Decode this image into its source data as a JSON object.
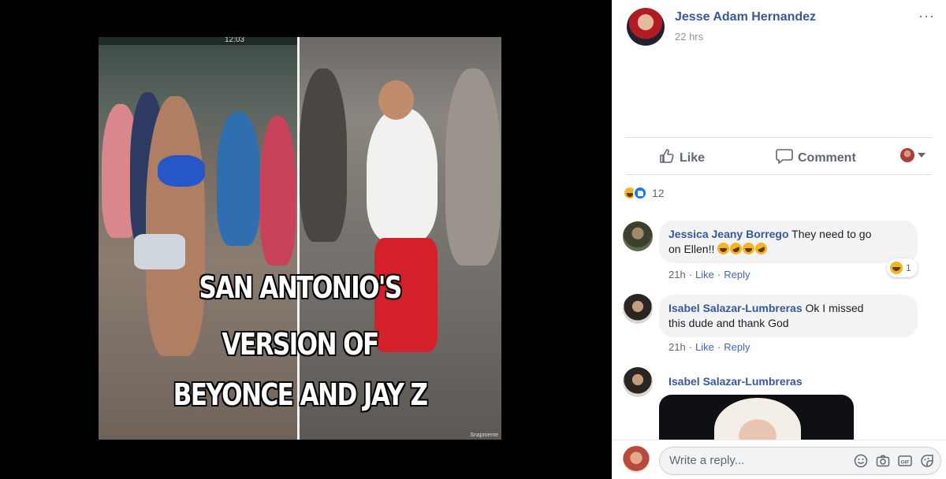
{
  "photo": {
    "status_time": "12:03",
    "caption_lines": [
      "SAN ANTONIO'S",
      "VERSION OF",
      "BEYONCE AND JAY Z"
    ],
    "watermark": "Snapmeme"
  },
  "post": {
    "author": "Jesse Adam Hernandez",
    "time": "22 hrs",
    "more": "···"
  },
  "actions": {
    "like_label": "Like",
    "comment_label": "Comment"
  },
  "reactions": {
    "count": "12",
    "types": [
      "haha",
      "like"
    ]
  },
  "comments": [
    {
      "author": "Jessica Jeany Borrego",
      "text_line1": "They need to go",
      "text_line2": "on Ellen!!",
      "time": "21h",
      "like": "Like",
      "reply": "Reply",
      "reaction_count": "1"
    },
    {
      "author": "Isabel Salazar-Lumbreras",
      "text_line1": "Ok I missed",
      "text_line2": "this dude and thank God",
      "time": "21h",
      "like": "Like",
      "reply": "Reply"
    },
    {
      "author": "Isabel Salazar-Lumbreras"
    }
  ],
  "reply_box": {
    "placeholder": "Write a reply..."
  },
  "colors": {
    "link_blue": "#385898",
    "action_gray": "#606770",
    "bubble_bg": "#f2f3f5"
  }
}
